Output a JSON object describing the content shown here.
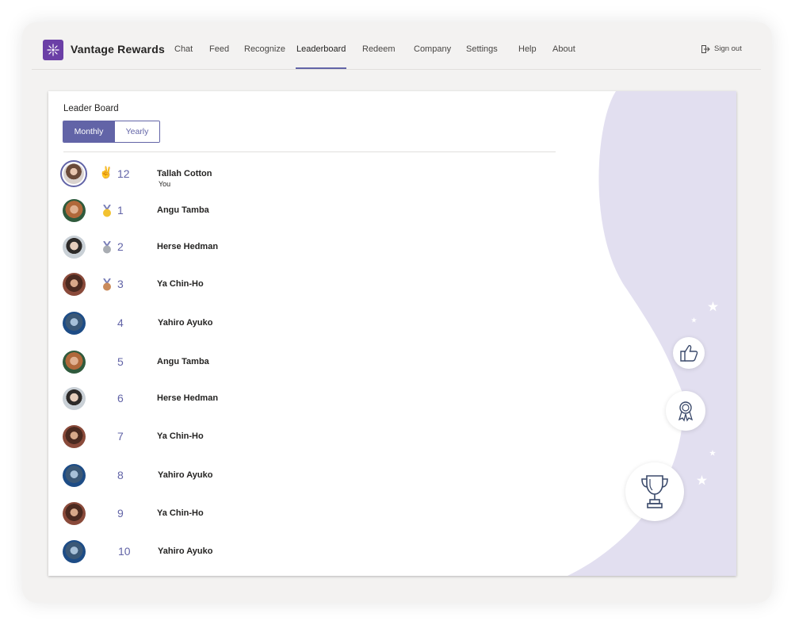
{
  "app": {
    "title": "Vantage Rewards",
    "logo_icon": "sparkle-icon",
    "brand_color": "#6b3fa6",
    "accent_color": "#6264a7"
  },
  "nav": {
    "items": [
      {
        "label": "Chat"
      },
      {
        "label": "Feed"
      },
      {
        "label": "Recognize"
      },
      {
        "label": "Leaderboard",
        "active": true
      },
      {
        "label": "Redeem"
      },
      {
        "label": "Company"
      },
      {
        "label": "Settings"
      },
      {
        "label": "Help"
      },
      {
        "label": "About"
      }
    ],
    "signout_label": "Sign out"
  },
  "leaderboard": {
    "title": "Leader Board",
    "toggle": {
      "monthly": "Monthly",
      "yearly": "Yearly",
      "selected": "Monthly"
    },
    "current_user": {
      "name": "Tallah Cotton",
      "rank": "12",
      "badge": "You",
      "icon": "victory-hand-icon"
    },
    "rows": [
      {
        "rank": "1",
        "name": "Angu Tamba",
        "medal": "gold"
      },
      {
        "rank": "2",
        "name": "Herse Hedman",
        "medal": "silver"
      },
      {
        "rank": "3",
        "name": "Ya Chin-Ho",
        "medal": "bronze"
      },
      {
        "rank": "4",
        "name": "Yahiro Ayuko",
        "medal": ""
      },
      {
        "rank": "5",
        "name": "Angu Tamba",
        "medal": ""
      },
      {
        "rank": "6",
        "name": "Herse Hedman",
        "medal": ""
      },
      {
        "rank": "7",
        "name": "Ya Chin-Ho",
        "medal": ""
      },
      {
        "rank": "8",
        "name": "Yahiro Ayuko",
        "medal": ""
      },
      {
        "rank": "9",
        "name": "Ya Chin-Ho",
        "medal": ""
      },
      {
        "rank": "10",
        "name": "Yahiro Ayuko",
        "medal": ""
      }
    ]
  },
  "decorations": {
    "icons": [
      "thumbs-up-icon",
      "award-ribbon-icon",
      "trophy-icon",
      "star-icon"
    ],
    "shape_color": "#e2dff0"
  }
}
